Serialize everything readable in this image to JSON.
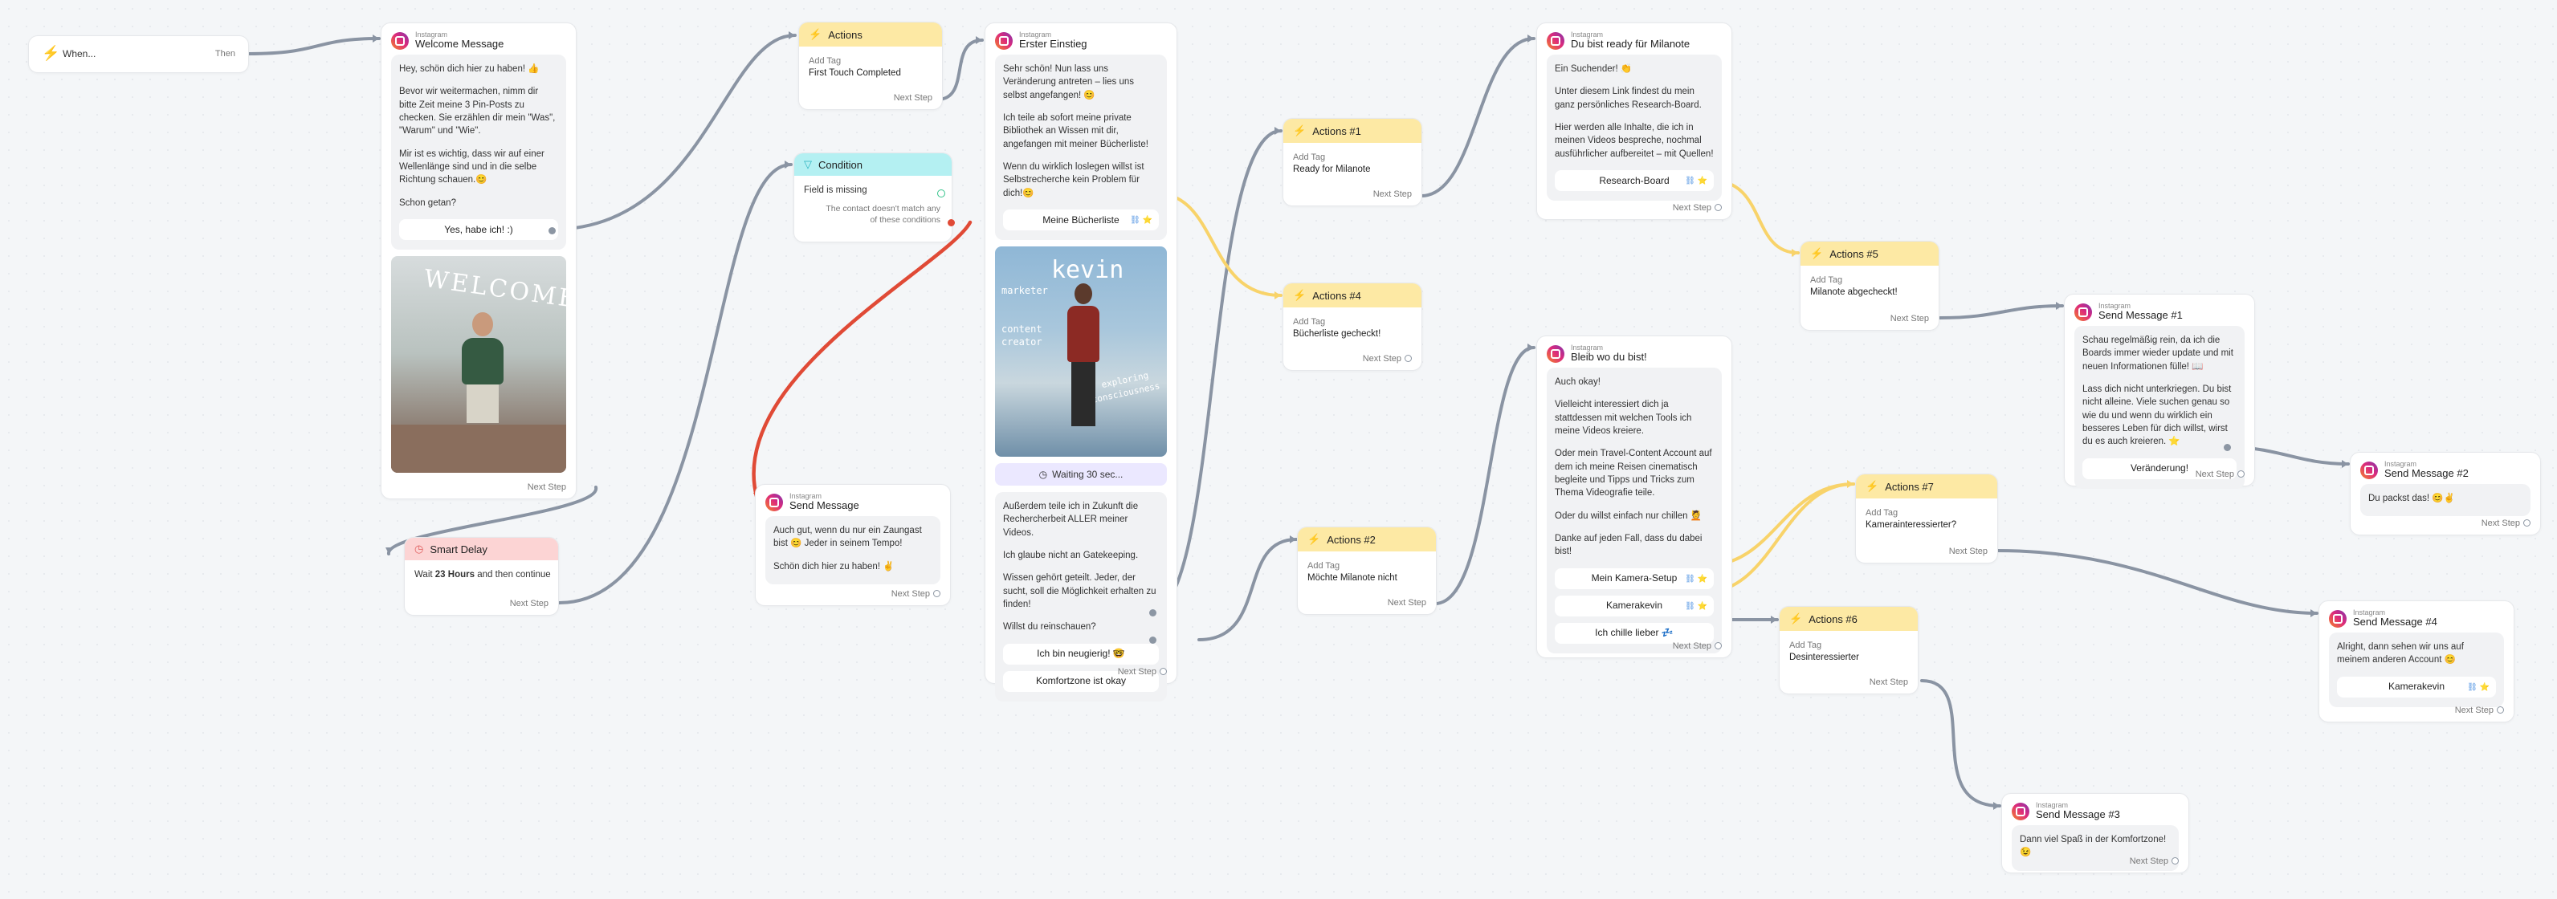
{
  "trigger": {
    "label": "When...",
    "then_label": "Then"
  },
  "common": {
    "next_step": "Next Step",
    "platform": "Instagram",
    "add_tag": "Add Tag"
  },
  "welcome": {
    "title": "Welcome Message",
    "paragraphs": [
      "Hey, schön dich hier zu haben! 👍",
      "Bevor wir weitermachen, nimm dir bitte Zeit meine 3 Pin-Posts zu checken. Sie erzählen dir mein \"Was\", \"Warum\" und \"Wie\".",
      "Mir ist es wichtig, dass wir auf einer Wellenlänge sind und in die selbe Richtung schauen.😊",
      "Schon getan?"
    ],
    "button": "Yes, habe ich! :)",
    "photo_caption": "WELCOME"
  },
  "smart_delay": {
    "title": "Smart Delay",
    "prefix": "Wait",
    "amount": "23 Hours",
    "suffix": "and then continue"
  },
  "actions_first": {
    "title": "Actions",
    "value": "First Touch Completed"
  },
  "condition": {
    "title": "Condition",
    "rule": "Field is missing",
    "fallback": "The contact doesn't match any of these conditions"
  },
  "send_message_1": {
    "title": "Send Message",
    "paragraphs": [
      "Auch gut, wenn du nur ein Zaungast bist 😊 Jeder in seinem Tempo!",
      "Schön dich hier zu haben! ✌️"
    ]
  },
  "erster": {
    "title": "Erster Einstieg",
    "paragraphs": [
      "Sehr schön! Nun lass uns Veränderung antreten – lies uns selbst angefangen! 😊",
      "Ich teile ab sofort meine private Bibliothek an Wissen mit dir, angefangen mit meiner Bücherliste!",
      "Wenn du wirklich loslegen willst ist Selbstrecherche kein Problem für dich!😊"
    ],
    "button": "Meine Bücherliste",
    "photo_words": [
      "kevin",
      "marketer",
      "content",
      "creator",
      "exploring",
      "consciousness"
    ],
    "wait_label": "Waiting 30 sec...",
    "paragraphs2": [
      "Außerdem teile ich in Zukunft die Rechercherbeit ALLER meiner Videos.",
      "Ich glaube nicht an Gatekeeping.",
      "Wissen gehört geteilt. Jeder, der sucht, soll die Möglichkeit erhalten zu finden!",
      "Willst du reinschauen?"
    ],
    "button2": "Ich bin neugierig! 🤓",
    "button3": "Komfortzone ist okay"
  },
  "actions_1": {
    "title": "Actions #1",
    "value": "Ready for Milanote"
  },
  "actions_4": {
    "title": "Actions #4",
    "value": "Bücherliste gecheckt!"
  },
  "actions_2": {
    "title": "Actions #2",
    "value": "Möchte Milanote nicht"
  },
  "ready": {
    "title": "Du bist ready für Milanote",
    "paragraphs": [
      "Ein Suchender! 👏",
      "Unter diesem Link findest du mein ganz persönliches Research-Board.",
      "Hier werden alle Inhalte, die ich in meinen Videos bespreche, nochmal ausführlicher aufbereitet – mit Quellen!"
    ],
    "button": "Research-Board"
  },
  "bleib": {
    "title": "Bleib wo du bist!",
    "paragraphs": [
      "Auch okay!",
      "Vielleicht interessiert dich ja stattdessen mit welchen Tools ich meine Videos kreiere.",
      "Oder mein Travel-Content Account auf dem ich meine Reisen cinematisch begleite und Tipps und Tricks zum Thema Videografie teile.",
      "Oder du willst einfach nur chillen 💆",
      "Danke auf jeden Fall, dass du dabei bist!"
    ],
    "buttons": [
      "Mein Kamera-Setup",
      "Kamerakevin",
      "Ich chille lieber 💤"
    ]
  },
  "actions_5": {
    "title": "Actions #5",
    "value": "Milanote abgecheckt!"
  },
  "actions_7": {
    "title": "Actions #7",
    "value": "Kamerainteressierter?"
  },
  "actions_6": {
    "title": "Actions #6",
    "value": "Desinteressierter"
  },
  "send_1": {
    "title": "Send Message #1",
    "paragraphs": [
      "Schau regelmäßig rein, da ich die Boards immer wieder update und mit neuen Informationen fülle! 📖",
      "Lass dich nicht unterkriegen. Du bist nicht alleine. Viele suchen genau so wie du und wenn du wirklich ein besseres Leben für dich willst, wirst du es auch kreieren. ⭐"
    ],
    "button": "Veränderung!"
  },
  "send_2": {
    "title": "Send Message #2",
    "text": "Du packst das! 😊✌️"
  },
  "send_3": {
    "title": "Send Message #3",
    "text": "Dann viel Spaß in der Komfortzone! 😉"
  },
  "send_4": {
    "title": "Send Message #4",
    "text": "Alright, dann sehen wir uns auf meinem anderen Account 😊",
    "button": "Kamerakevin"
  }
}
